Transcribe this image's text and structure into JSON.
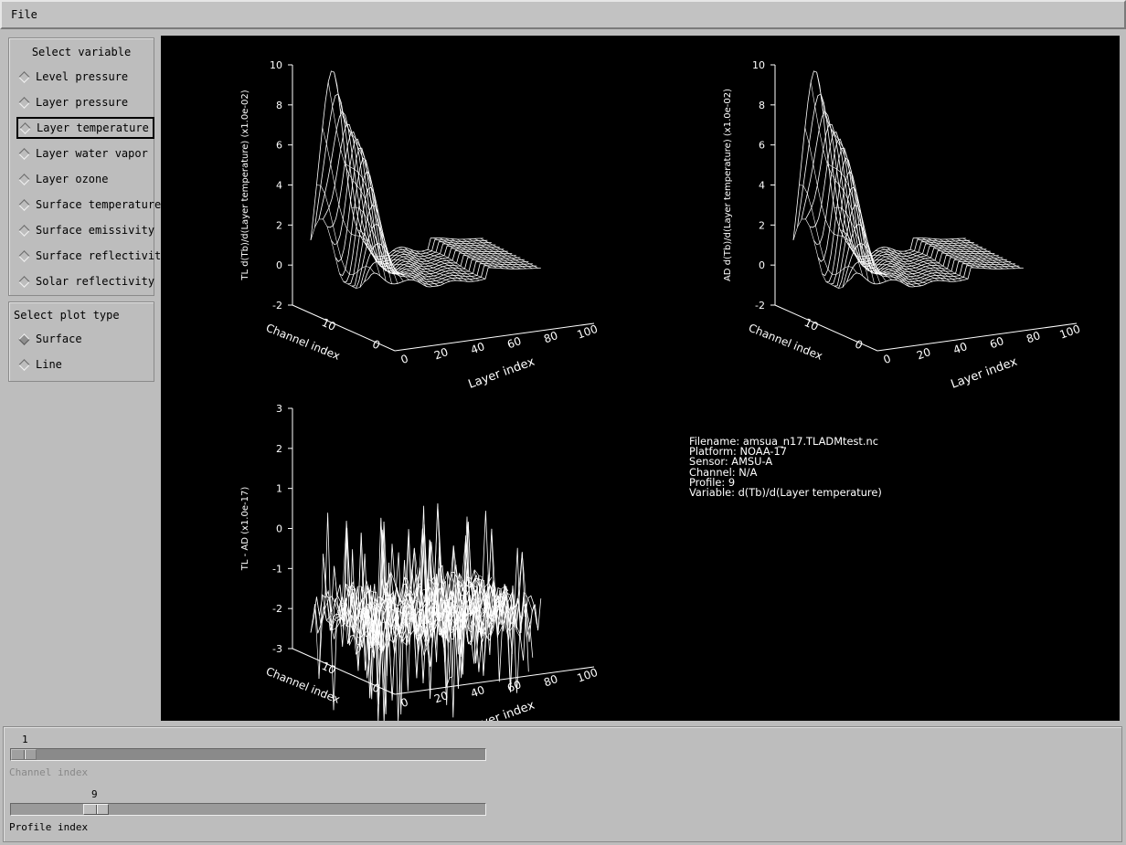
{
  "menubar": {
    "file_label": "File"
  },
  "variables": {
    "title": "Select variable",
    "items": [
      {
        "label": "Level pressure"
      },
      {
        "label": "Layer pressure"
      },
      {
        "label": "Layer temperature",
        "selected": true
      },
      {
        "label": "Layer water vapor"
      },
      {
        "label": "Layer ozone"
      },
      {
        "label": "Surface temperature"
      },
      {
        "label": "Surface emissivity"
      },
      {
        "label": "Surface reflectivity"
      },
      {
        "label": "Solar reflectivity"
      }
    ]
  },
  "plot_type": {
    "title": "Select plot type",
    "items": [
      {
        "label": "Surface",
        "checked": true
      },
      {
        "label": "Line"
      }
    ]
  },
  "plots": {
    "tl": {
      "zlabel": "TL d(Tb)/d(Layer temperature) (x1.0e-02)",
      "zticks": [
        "10",
        "8",
        "6",
        "4",
        "2",
        "0",
        "-2"
      ],
      "xlabel": "Layer index",
      "xticks": [
        "0",
        "20",
        "40",
        "60",
        "80",
        "100"
      ],
      "ylabel": "Channel index",
      "yticks": [
        "0",
        "10"
      ]
    },
    "ad": {
      "zlabel": "AD d(Tb)/d(Layer temperature) (x1.0e-02)",
      "zticks": [
        "10",
        "8",
        "6",
        "4",
        "2",
        "0",
        "-2"
      ],
      "xlabel": "Layer index",
      "xticks": [
        "0",
        "20",
        "40",
        "60",
        "80",
        "100"
      ],
      "ylabel": "Channel index",
      "yticks": [
        "0",
        "10"
      ]
    },
    "diff": {
      "zlabel": "TL - AD (x1.0e-17)",
      "zticks": [
        "3",
        "2",
        "1",
        "0",
        "-1",
        "-2",
        "-3"
      ],
      "xlabel": "Layer index",
      "xticks": [
        "0",
        "20",
        "40",
        "60",
        "80",
        "100"
      ],
      "ylabel": "Channel index",
      "yticks": [
        "0",
        "10"
      ]
    }
  },
  "info": {
    "filename": "Filename: amsua_n17.TLADMtest.nc",
    "platform": "Platform: NOAA-17",
    "sensor": "Sensor: AMSU-A",
    "channel": "Channel: N/A",
    "profile": "Profile: 9",
    "variable": "Variable: d(Tb)/d(Layer temperature)"
  },
  "channel_slider": {
    "value": "1",
    "label": "Channel index",
    "enabled": false,
    "position": 0.0
  },
  "profile_slider": {
    "value": "9",
    "label": "Profile index",
    "enabled": true,
    "position": 0.16
  },
  "colors": {
    "background": "#bdbdbd",
    "plot_background": "#000000",
    "plot_lines": "#ffffff"
  }
}
